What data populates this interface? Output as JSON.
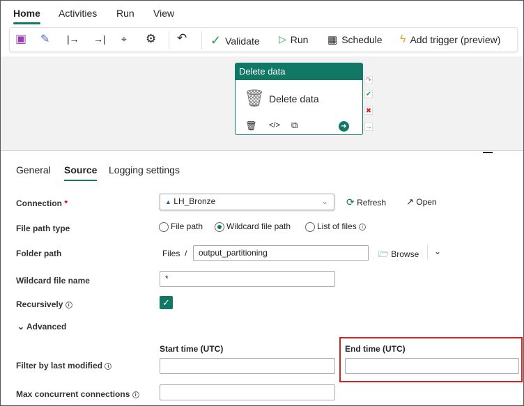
{
  "menu": {
    "tabs": [
      "Home",
      "Activities",
      "Run",
      "View"
    ]
  },
  "toolbar": {
    "validate": "Validate",
    "run": "Run",
    "schedule": "Schedule",
    "add_trigger": "Add trigger (preview)"
  },
  "node": {
    "header": "Delete data",
    "title": "Delete data"
  },
  "panel": {
    "tabs": [
      "General",
      "Source",
      "Logging settings"
    ]
  },
  "form": {
    "connection_label": "Connection",
    "required": "*",
    "connection_value": "LH_Bronze",
    "refresh": "Refresh",
    "open": "Open",
    "file_path_type_label": "File path type",
    "options": [
      "File path",
      "Wildcard file path",
      "List of files"
    ],
    "folder_path_label": "Folder path",
    "folder_prefix": "Files",
    "folder_sep": "/",
    "folder_value": "output_partitioning",
    "browse": "Browse",
    "wildcard_label": "Wildcard file name",
    "wildcard_value": "*",
    "recursively_label": "Recursively",
    "advanced": "Advanced",
    "start_time_label": "Start time (UTC)",
    "end_time_label": "End time (UTC)",
    "filter_label": "Filter by last modified",
    "max_conn_label": "Max concurrent connections"
  },
  "colors": {
    "accent": "#117865",
    "highlight": "#d92020"
  }
}
